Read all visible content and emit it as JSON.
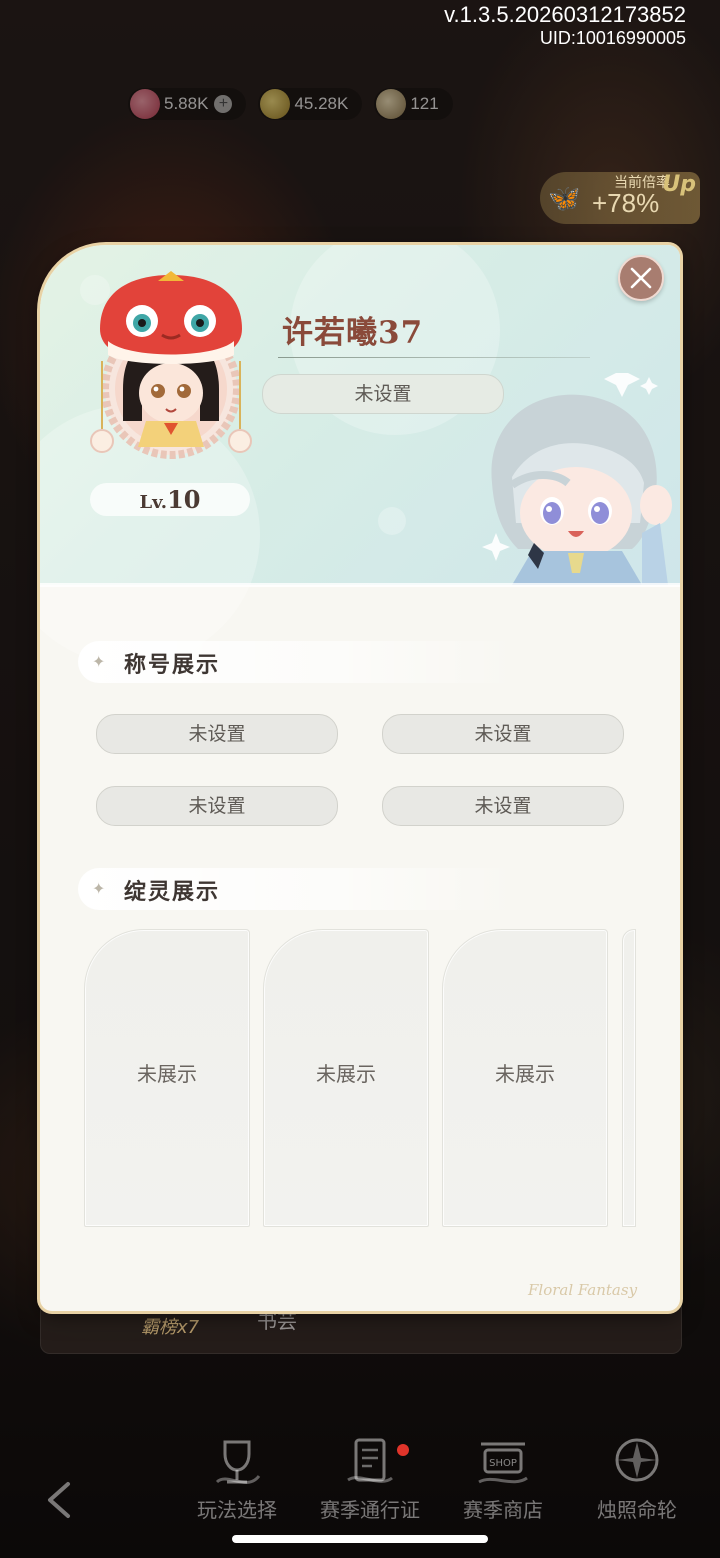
{
  "app": {
    "version": "v.1.3.5.20260312173852",
    "uid": "UID:10016990005"
  },
  "currencies": [
    {
      "icon": "gem-icon",
      "value": "5.88K",
      "color": "#d9566a"
    },
    {
      "icon": "gold-coin-icon",
      "value": "45.28K",
      "color": "#c9a83a"
    },
    {
      "icon": "star-token-icon",
      "value": "121",
      "color": "#c7b48a"
    }
  ],
  "rate_badge": {
    "label": "当前倍率",
    "value": "+78%",
    "suffix": "Up"
  },
  "background_panel": {
    "ranker": "霸榜x7",
    "name": "书芸"
  },
  "profile": {
    "name": "许若曦37",
    "signature": "未设置",
    "level_prefix": "Lv.",
    "level": "10"
  },
  "titles_section": {
    "heading": "称号展示",
    "slots": [
      "未设置",
      "未设置",
      "未设置",
      "未设置"
    ]
  },
  "spirits_section": {
    "heading": "绽灵展示",
    "cards": [
      "未展示",
      "未展示",
      "未展示"
    ]
  },
  "modal_watermark": "Floral Fantasy",
  "bottom_nav": [
    {
      "label": "玩法选择",
      "icon": "trophy-icon",
      "badge": false
    },
    {
      "label": "赛季通行证",
      "icon": "scroll-icon",
      "badge": true
    },
    {
      "label": "赛季商店",
      "icon": "shop-icon",
      "badge": false
    },
    {
      "label": "烛照命轮",
      "icon": "compass-wheel-icon",
      "badge": false
    }
  ],
  "theme": {
    "close_button": "#a87d70",
    "name_color": "#8a4a3a",
    "modal_border": "#e8d2a5"
  }
}
